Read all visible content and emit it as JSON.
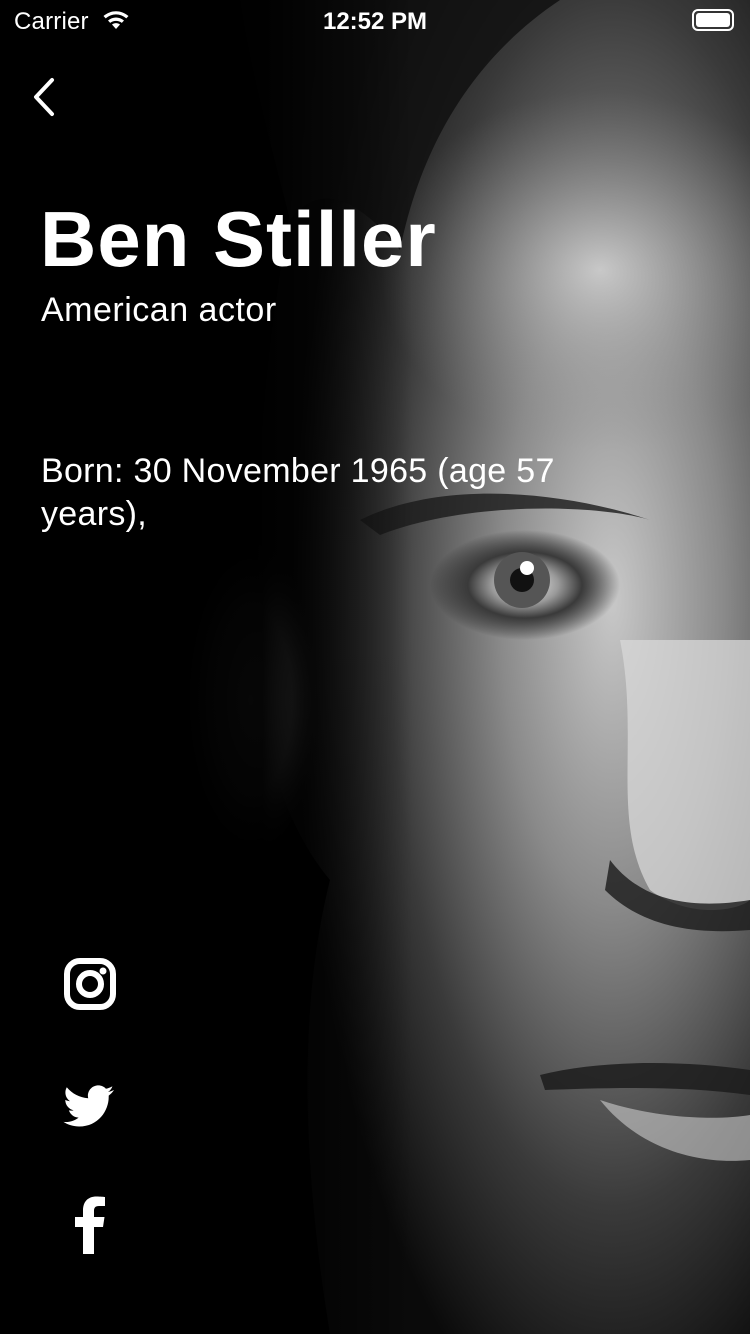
{
  "status_bar": {
    "carrier": "Carrier",
    "time": "12:52 PM"
  },
  "navigation": {
    "back_icon": "chevron-left-icon"
  },
  "profile": {
    "name": "Ben Stiller",
    "description": "American actor",
    "born": "Born: 30 November 1965 (age 57 years),"
  },
  "social": [
    {
      "network": "Instagram",
      "icon": "instagram-icon"
    },
    {
      "network": "Twitter",
      "icon": "twitter-icon"
    },
    {
      "network": "Facebook",
      "icon": "facebook-icon"
    }
  ],
  "colors": {
    "background": "#000000",
    "text": "#ffffff",
    "button_background": "#000000"
  }
}
